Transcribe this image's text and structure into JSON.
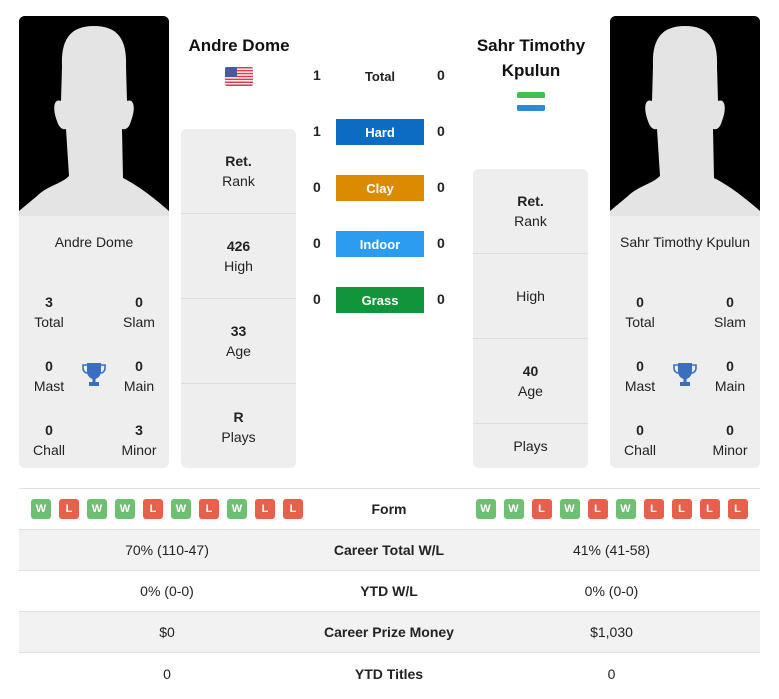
{
  "colors": {
    "hard": "#0c6bc2",
    "clay": "#dc8b00",
    "indoor": "#2b9cf0",
    "grass": "#10953a",
    "win": "#6fbf73",
    "loss": "#e8604c",
    "trophy": "#3a6fbf"
  },
  "player1": {
    "name": "Andre Dome",
    "flag": "us-flag",
    "card_name": "Andre Dome",
    "titles": {
      "total": {
        "value": "3",
        "label": "Total"
      },
      "slam": {
        "value": "0",
        "label": "Slam"
      },
      "mast": {
        "value": "0",
        "label": "Mast"
      },
      "main": {
        "value": "0",
        "label": "Main"
      },
      "chall": {
        "value": "0",
        "label": "Chall"
      },
      "minor": {
        "value": "3",
        "label": "Minor"
      }
    },
    "info": [
      {
        "value": "Ret.",
        "label": "Rank"
      },
      {
        "value": "426",
        "label": "High"
      },
      {
        "value": "33",
        "label": "Age"
      },
      {
        "value": "R",
        "label": "Plays"
      }
    ]
  },
  "player2": {
    "name": "Sahr Timothy Kpulun",
    "flag": "sierra-leone-flag",
    "card_name": "Sahr Timothy Kpulun",
    "titles": {
      "total": {
        "value": "0",
        "label": "Total"
      },
      "slam": {
        "value": "0",
        "label": "Slam"
      },
      "mast": {
        "value": "0",
        "label": "Mast"
      },
      "main": {
        "value": "0",
        "label": "Main"
      },
      "chall": {
        "value": "0",
        "label": "Chall"
      },
      "minor": {
        "value": "0",
        "label": "Minor"
      }
    },
    "info": [
      {
        "value": "Ret.",
        "label": "Rank"
      },
      {
        "value": "",
        "label": "High"
      },
      {
        "value": "40",
        "label": "Age"
      },
      {
        "value": "",
        "label": "Plays"
      }
    ]
  },
  "h2h": [
    {
      "label": "Total",
      "left": "1",
      "right": "0",
      "surface": "total"
    },
    {
      "label": "Hard",
      "left": "1",
      "right": "0",
      "surface": "hard"
    },
    {
      "label": "Clay",
      "left": "0",
      "right": "0",
      "surface": "clay"
    },
    {
      "label": "Indoor",
      "left": "0",
      "right": "0",
      "surface": "indoor"
    },
    {
      "label": "Grass",
      "left": "0",
      "right": "0",
      "surface": "grass"
    }
  ],
  "comparison": {
    "form_label": "Form",
    "form_left": [
      "W",
      "L",
      "W",
      "W",
      "L",
      "W",
      "L",
      "W",
      "L",
      "L"
    ],
    "form_right": [
      "W",
      "W",
      "L",
      "W",
      "L",
      "W",
      "L",
      "L",
      "L",
      "L"
    ],
    "rows": [
      {
        "label": "Career Total W/L",
        "left": "70% (110-47)",
        "right": "41% (41-58)"
      },
      {
        "label": "YTD W/L",
        "left": "0% (0-0)",
        "right": "0% (0-0)"
      },
      {
        "label": "Career Prize Money",
        "left": "$0",
        "right": "$1,030"
      },
      {
        "label": "YTD Titles",
        "left": "0",
        "right": "0"
      }
    ]
  }
}
